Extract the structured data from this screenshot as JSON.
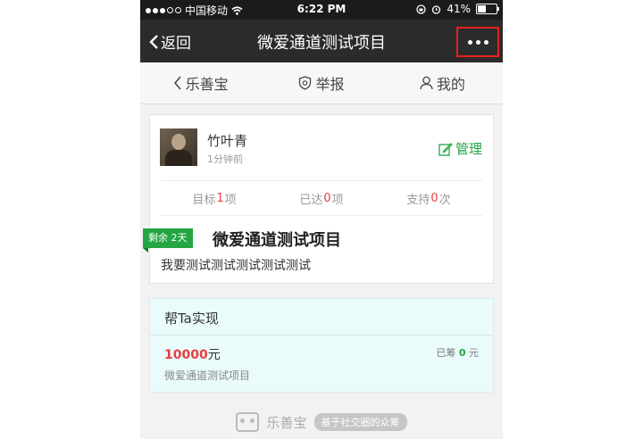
{
  "status_bar": {
    "carrier": "中国移动",
    "time": "6:22 PM",
    "battery": "41%",
    "battery_level": 0.41,
    "signal_icon": "signal-dots-icon",
    "wifi_icon": "wifi-icon"
  },
  "navbar": {
    "back_label": "返回",
    "title": "微爱通道测试项目",
    "more_icon": "more-dots-icon",
    "highlight_color": "#e8201f"
  },
  "tabs": [
    {
      "label": "乐善宝",
      "icon": "chevron-left-icon"
    },
    {
      "label": "举报",
      "icon": "shield-icon"
    },
    {
      "label": "我的",
      "icon": "user-icon"
    }
  ],
  "post": {
    "user_name": "竹叶青",
    "time_ago": "1分钟前",
    "manage_label": "管理",
    "stats": {
      "goal_prefix": "目标",
      "goal_num": "1",
      "goal_suffix": "项",
      "done_prefix": "已达",
      "done_num": "0",
      "done_suffix": "项",
      "support_prefix": "支持",
      "support_num": "0",
      "support_suffix": "次"
    },
    "badge": "剩余 2天",
    "project_title": "微爱通道测试项目",
    "project_desc": "我要测试测试测试测试测试"
  },
  "help": {
    "title": "帮Ta实现",
    "amount_value": "10000",
    "amount_unit": "元",
    "raised_prefix": "已筹",
    "raised_num": "0",
    "raised_unit": "元",
    "project_name": "微爱通道测试项目"
  },
  "footer": {
    "brand": "乐善宝",
    "tagline": "基于社交圈的众筹"
  },
  "colors": {
    "accent_green": "#23a543",
    "accent_red": "#e83d3d",
    "nav_bg": "#2b2b2b"
  }
}
